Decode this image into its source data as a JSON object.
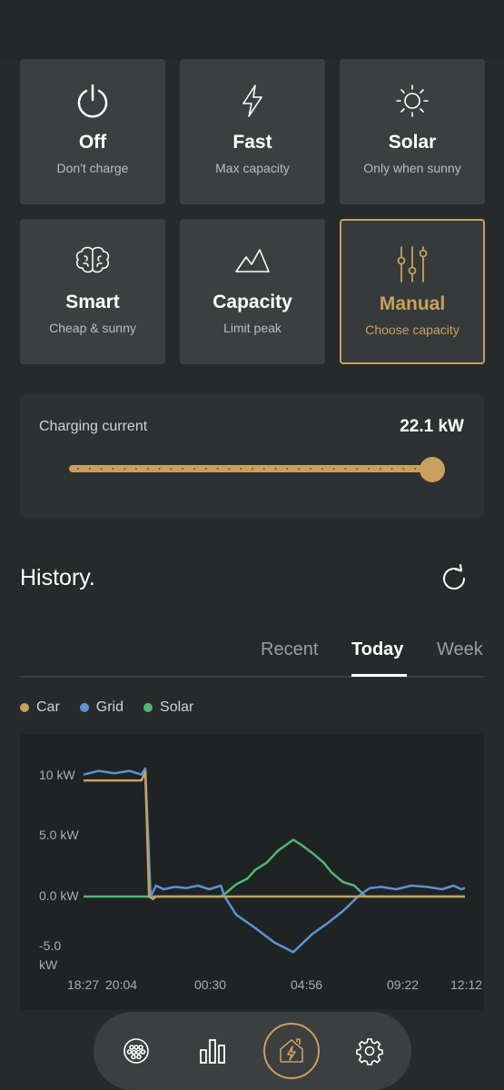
{
  "modes": [
    {
      "title": "Off",
      "subtitle": "Don't charge",
      "icon": "power-icon",
      "active": false
    },
    {
      "title": "Fast",
      "subtitle": "Max capacity",
      "icon": "lightning-icon",
      "active": false
    },
    {
      "title": "Solar",
      "subtitle": "Only when sunny",
      "icon": "sun-icon",
      "active": false
    },
    {
      "title": "Smart",
      "subtitle": "Cheap & sunny",
      "icon": "brain-icon",
      "active": false
    },
    {
      "title": "Capacity",
      "subtitle": "Limit peak",
      "icon": "mountain-icon",
      "active": false
    },
    {
      "title": "Manual",
      "subtitle": "Choose capacity",
      "icon": "sliders-icon",
      "active": true
    }
  ],
  "charging": {
    "label": "Charging current",
    "value": "22.1 kW",
    "slider_level": 1.0
  },
  "history": {
    "title": "History.",
    "tabs": [
      {
        "label": "Recent",
        "active": false
      },
      {
        "label": "Today",
        "active": true
      },
      {
        "label": "Week",
        "active": false
      }
    ]
  },
  "colors": {
    "accent": "#c9a05d",
    "car": "#c9a05d",
    "grid": "#5b93d6",
    "solar": "#4fb873"
  },
  "chart_data": {
    "type": "line",
    "x_tick_labels": [
      "18:27",
      "20:04",
      "00:30",
      "04:56",
      "09:22",
      "12:12"
    ],
    "y_tick_labels": [
      "10 kW",
      "5.0 kW",
      "0.0 kW",
      "-5.0 kW"
    ],
    "y_ticks": [
      10,
      5,
      0,
      -5
    ],
    "ylim": [
      -5.7,
      11
    ],
    "legend": [
      "Car",
      "Grid",
      "Solar"
    ],
    "grid": false,
    "series": [
      {
        "name": "Car",
        "x": [
          0,
          0.152,
          0.162,
          0.172,
          0.182,
          0.19,
          1.0
        ],
        "y": [
          9.6,
          9.6,
          10.3,
          0.0,
          -0.2,
          0.0,
          0.0
        ]
      },
      {
        "name": "Grid",
        "x": [
          0,
          0.04,
          0.08,
          0.12,
          0.152,
          0.162,
          0.176,
          0.19,
          0.21,
          0.24,
          0.27,
          0.3,
          0.33,
          0.36,
          0.37,
          0.4,
          0.45,
          0.5,
          0.55,
          0.6,
          0.64,
          0.68,
          0.72,
          0.75,
          0.78,
          0.82,
          0.86,
          0.9,
          0.94,
          0.97,
          0.99,
          1.0
        ],
        "y": [
          10.1,
          10.4,
          10.2,
          10.4,
          10.1,
          10.6,
          0.0,
          0.9,
          0.6,
          0.8,
          0.7,
          0.9,
          0.6,
          0.9,
          0.0,
          -1.5,
          -2.6,
          -3.8,
          -4.6,
          -3.1,
          -2.2,
          -1.2,
          0.0,
          0.7,
          0.8,
          0.6,
          0.9,
          0.8,
          0.6,
          0.9,
          0.6,
          0.7
        ]
      },
      {
        "name": "Solar",
        "x": [
          0,
          0.36,
          0.37,
          0.4,
          0.43,
          0.45,
          0.48,
          0.51,
          0.55,
          0.57,
          0.6,
          0.63,
          0.65,
          0.68,
          0.71,
          0.74,
          1.0
        ],
        "y": [
          0.0,
          0.0,
          0.2,
          1.0,
          1.5,
          2.2,
          2.8,
          3.8,
          4.7,
          4.3,
          3.6,
          2.8,
          2.0,
          1.2,
          0.9,
          0.0,
          0.0
        ]
      }
    ]
  },
  "nav": [
    {
      "icon": "charger-plug-icon",
      "active": false
    },
    {
      "icon": "bar-chart-icon",
      "active": false
    },
    {
      "icon": "home-lightning-icon",
      "active": true
    },
    {
      "icon": "gear-icon",
      "active": false
    }
  ]
}
